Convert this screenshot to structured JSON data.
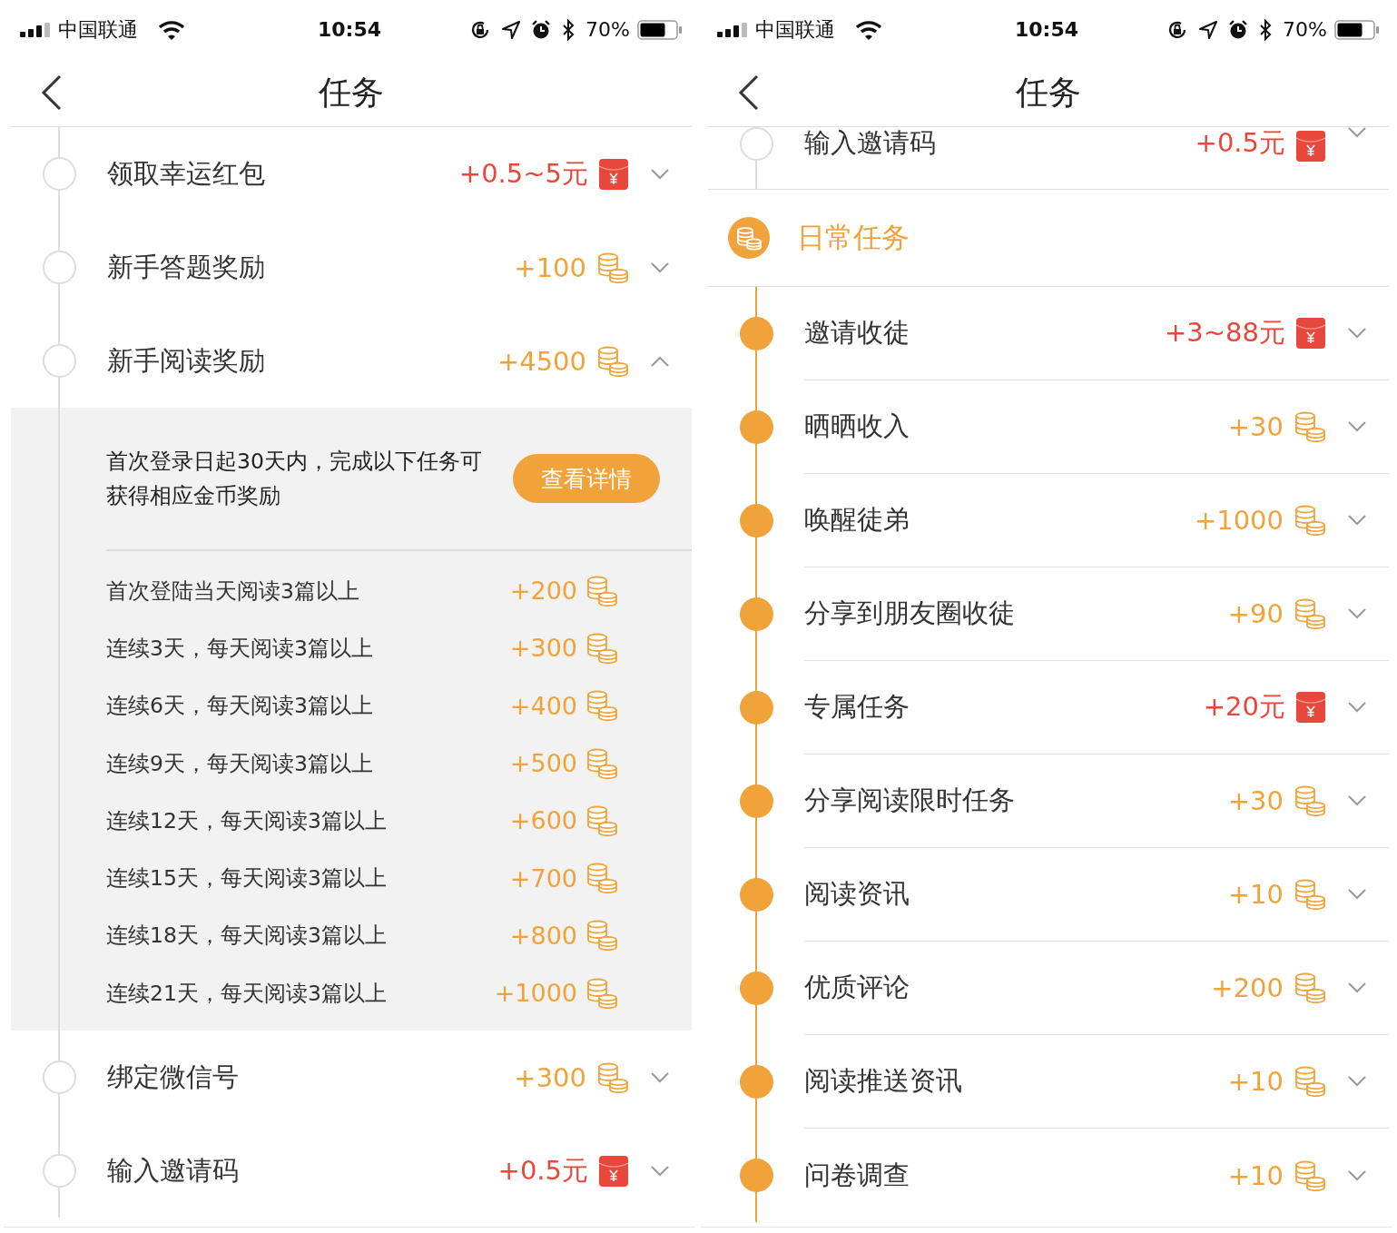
{
  "screens": [
    {
      "status_bar": {
        "carrier": "中国联通",
        "time": "10:54",
        "battery": "70%"
      },
      "title": "任务",
      "blocks": [
        {
          "kind": "tasks",
          "divided": false,
          "clipped": false,
          "items": [
            {
              "name": "领取幸运红包",
              "reward": "+0.5~5元",
              "kind": "cash",
              "dot_filled": false,
              "expanded": false
            },
            {
              "name": "新手答题奖励",
              "reward": "+100",
              "kind": "coins",
              "dot_filled": false,
              "expanded": false
            },
            {
              "name": "新手阅读奖励",
              "reward": "+4500",
              "kind": "coins",
              "dot_filled": false,
              "expanded": true,
              "detail": {
                "note": "首次登录日起30天内，完成以下任务可获得相应金币奖励",
                "button": "查看详情",
                "rows": [
                  {
                    "label": "首次登陆当天阅读3篇以上",
                    "reward": "+200"
                  },
                  {
                    "label": "连续3天，每天阅读3篇以上",
                    "reward": "+300"
                  },
                  {
                    "label": "连续6天，每天阅读3篇以上",
                    "reward": "+400"
                  },
                  {
                    "label": "连续9天，每天阅读3篇以上",
                    "reward": "+500"
                  },
                  {
                    "label": "连续12天，每天阅读3篇以上",
                    "reward": "+600"
                  },
                  {
                    "label": "连续15天，每天阅读3篇以上",
                    "reward": "+700"
                  },
                  {
                    "label": "连续18天，每天阅读3篇以上",
                    "reward": "+800"
                  },
                  {
                    "label": "连续21天，每天阅读3篇以上",
                    "reward": "+1000"
                  }
                ]
              }
            },
            {
              "name": "绑定微信号",
              "reward": "+300",
              "kind": "coins",
              "dot_filled": false,
              "expanded": false
            },
            {
              "name": "输入邀请码",
              "reward": "+0.5元",
              "kind": "cash",
              "dot_filled": false,
              "expanded": false
            }
          ]
        }
      ]
    },
    {
      "status_bar": {
        "carrier": "中国联通",
        "time": "10:54",
        "battery": "70%"
      },
      "title": "任务",
      "blocks": [
        {
          "kind": "tasks",
          "divided": false,
          "clipped": true,
          "items": [
            {
              "name": "输入邀请码",
              "reward": "+0.5元",
              "kind": "cash",
              "dot_filled": false,
              "expanded": false
            }
          ]
        },
        {
          "kind": "section",
          "title": "日常任务"
        },
        {
          "kind": "tasks",
          "divided": true,
          "clipped": false,
          "items": [
            {
              "name": "邀请收徒",
              "reward": "+3~88元",
              "kind": "cash",
              "dot_filled": true,
              "expanded": false
            },
            {
              "name": "晒晒收入",
              "reward": "+30",
              "kind": "coins",
              "dot_filled": true,
              "expanded": false
            },
            {
              "name": "唤醒徒弟",
              "reward": "+1000",
              "kind": "coins",
              "dot_filled": true,
              "expanded": false
            },
            {
              "name": "分享到朋友圈收徒",
              "reward": "+90",
              "kind": "coins",
              "dot_filled": true,
              "expanded": false
            },
            {
              "name": "专属任务",
              "reward": "+20元",
              "kind": "cash",
              "dot_filled": true,
              "expanded": false
            },
            {
              "name": "分享阅读限时任务",
              "reward": "+30",
              "kind": "coins",
              "dot_filled": true,
              "expanded": false
            },
            {
              "name": "阅读资讯",
              "reward": "+10",
              "kind": "coins",
              "dot_filled": true,
              "expanded": false
            },
            {
              "name": "优质评论",
              "reward": "+200",
              "kind": "coins",
              "dot_filled": true,
              "expanded": false
            },
            {
              "name": "阅读推送资讯",
              "reward": "+10",
              "kind": "coins",
              "dot_filled": true,
              "expanded": false
            },
            {
              "name": "问卷调查",
              "reward": "+10",
              "kind": "coins",
              "dot_filled": true,
              "expanded": false
            }
          ]
        }
      ]
    }
  ]
}
